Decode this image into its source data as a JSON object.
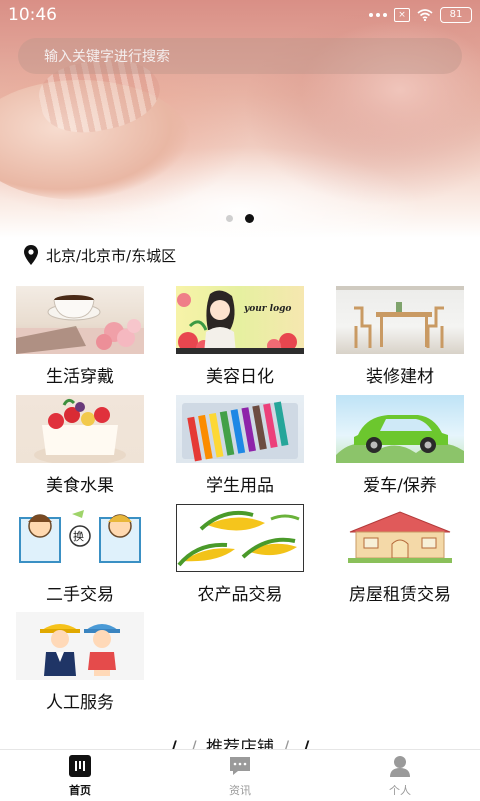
{
  "status_bar": {
    "time": "10:46",
    "battery": "81"
  },
  "search": {
    "placeholder": "输入关键字进行搜索"
  },
  "carousel": {
    "slide_count": 2,
    "active_index": 1
  },
  "location": {
    "text": "北京/北京市/东城区"
  },
  "categories": [
    {
      "label": "生活穿戴",
      "image": "teacup-flowers"
    },
    {
      "label": "美容日化",
      "image": "cartoon-girl-roses"
    },
    {
      "label": "装修建材",
      "image": "dining-table-chairs"
    },
    {
      "label": "美食水果",
      "image": "fruit-cake"
    },
    {
      "label": "学生用品",
      "image": "colored-pencils"
    },
    {
      "label": "爱车/保养",
      "image": "green-car"
    },
    {
      "label": "二手交易",
      "image": "cartoon-exchange"
    },
    {
      "label": "农产品交易",
      "image": "corn"
    },
    {
      "label": "房屋租赁交易",
      "image": "house"
    },
    {
      "label": "人工服务",
      "image": "workers"
    }
  ],
  "beauty_thumb": {
    "logo_text": "your logo"
  },
  "exchange_thumb": {
    "badge_text": "换"
  },
  "section": {
    "title": "推荐店铺",
    "slash": "/"
  },
  "tabbar": [
    {
      "label": "首页",
      "icon": "home-icon",
      "active": true
    },
    {
      "label": "资讯",
      "icon": "chat-icon",
      "active": false
    },
    {
      "label": "个人",
      "icon": "person-icon",
      "active": false
    }
  ]
}
